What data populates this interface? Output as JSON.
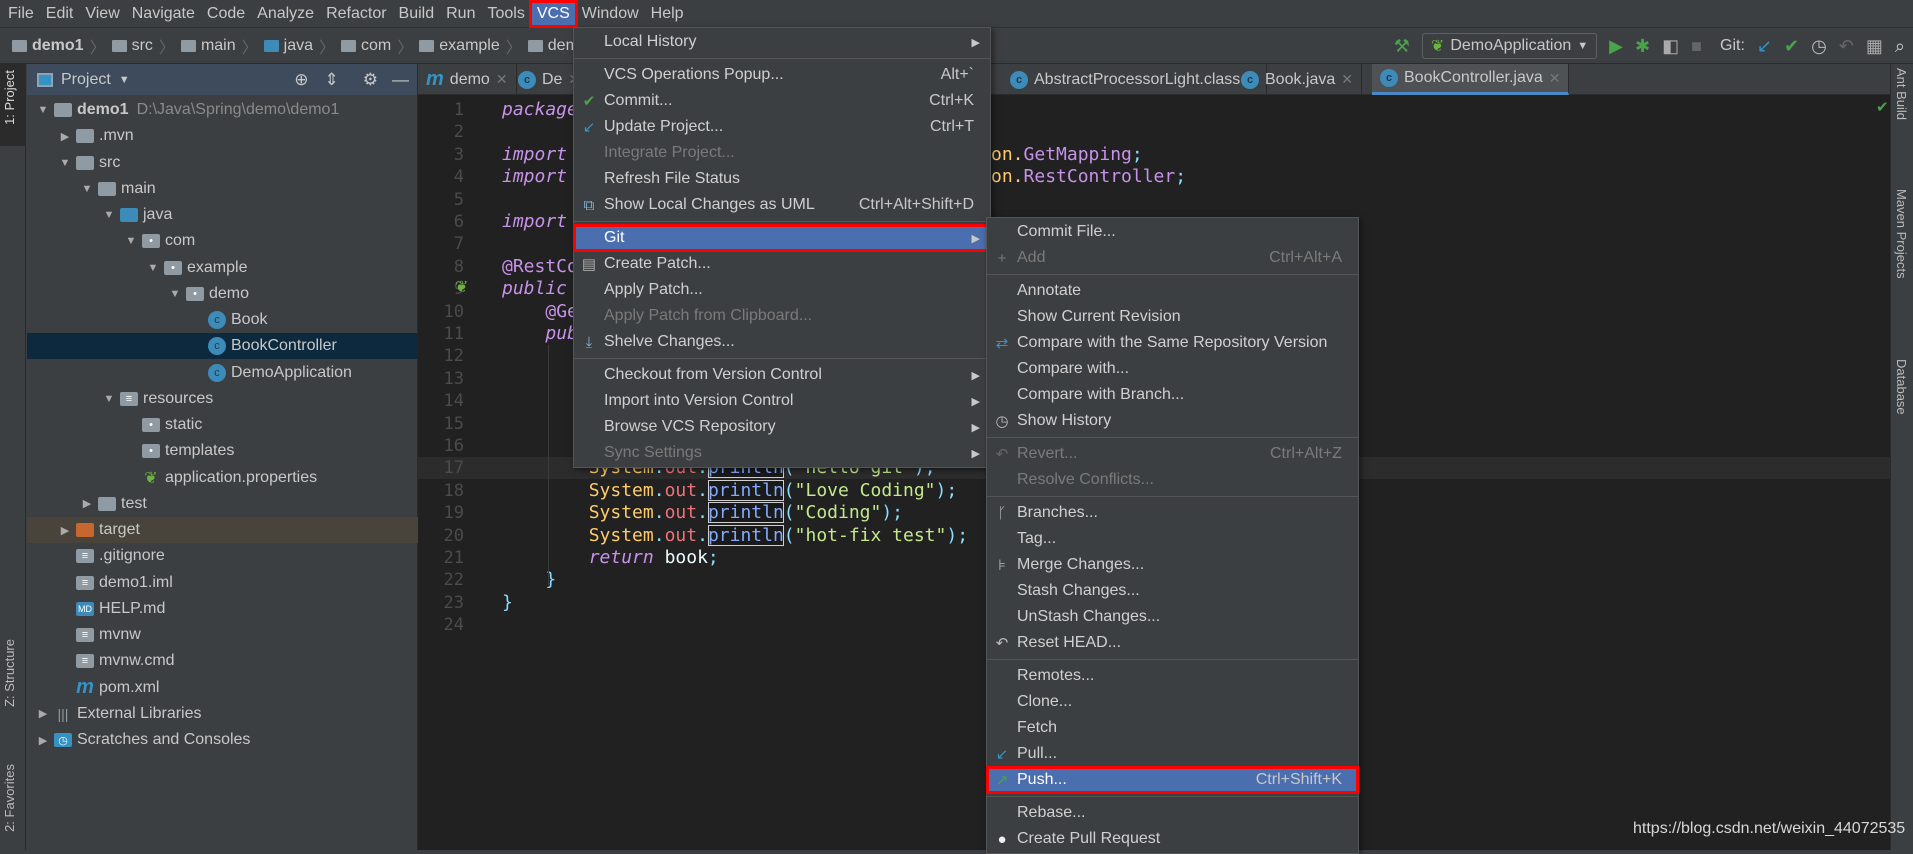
{
  "menubar": [
    "File",
    "Edit",
    "View",
    "Navigate",
    "Code",
    "Analyze",
    "Refactor",
    "Build",
    "Run",
    "Tools",
    "VCS",
    "Window",
    "Help"
  ],
  "menubar_active": "VCS",
  "breadcrumb": [
    "demo1",
    "src",
    "main",
    "java",
    "com",
    "example",
    "demo"
  ],
  "toolbar": {
    "run_config": "DemoApplication",
    "git_label": "Git:"
  },
  "left_stripe": {
    "project": "1: Project",
    "structure": "Z: Structure",
    "favorites": "2: Favorites"
  },
  "right_stripe": {
    "ant": "Ant Build",
    "maven": "Maven Projects",
    "database": "Database"
  },
  "project_panel": {
    "title": "Project",
    "tree": [
      {
        "label": "demo1",
        "hint": "D:\\Java\\Spring\\demo\\demo1",
        "depth": 0,
        "expand": "open",
        "icon": "module-folder",
        "bold": true
      },
      {
        "label": ".mvn",
        "depth": 1,
        "expand": "closed",
        "icon": "folder"
      },
      {
        "label": "src",
        "depth": 1,
        "expand": "open",
        "icon": "folder"
      },
      {
        "label": "main",
        "depth": 2,
        "expand": "open",
        "icon": "folder"
      },
      {
        "label": "java",
        "depth": 3,
        "expand": "open",
        "icon": "source-folder"
      },
      {
        "label": "com",
        "depth": 4,
        "expand": "open",
        "icon": "package"
      },
      {
        "label": "example",
        "depth": 5,
        "expand": "open",
        "icon": "package"
      },
      {
        "label": "demo",
        "depth": 6,
        "expand": "open",
        "icon": "package"
      },
      {
        "label": "Book",
        "depth": 7,
        "icon": "class"
      },
      {
        "label": "BookController",
        "depth": 7,
        "icon": "class",
        "selected": true
      },
      {
        "label": "DemoApplication",
        "depth": 7,
        "icon": "spring-class"
      },
      {
        "label": "resources",
        "depth": 3,
        "expand": "open",
        "icon": "resources-folder"
      },
      {
        "label": "static",
        "depth": 4,
        "icon": "package"
      },
      {
        "label": "templates",
        "depth": 4,
        "icon": "package"
      },
      {
        "label": "application.properties",
        "depth": 4,
        "icon": "spring-leaf"
      },
      {
        "label": "test",
        "depth": 2,
        "expand": "closed",
        "icon": "folder"
      },
      {
        "label": "target",
        "depth": 1,
        "expand": "closed",
        "icon": "excluded-folder",
        "highlight": true
      },
      {
        "label": ".gitignore",
        "depth": 1,
        "icon": "file"
      },
      {
        "label": "demo1.iml",
        "depth": 1,
        "icon": "file"
      },
      {
        "label": "HELP.md",
        "depth": 1,
        "icon": "markdown"
      },
      {
        "label": "mvnw",
        "depth": 1,
        "icon": "file"
      },
      {
        "label": "mvnw.cmd",
        "depth": 1,
        "icon": "file"
      },
      {
        "label": "pom.xml",
        "depth": 1,
        "icon": "maven"
      },
      {
        "label": "External Libraries",
        "depth": 0,
        "expand": "closed",
        "icon": "libraries"
      },
      {
        "label": "Scratches and Consoles",
        "depth": 0,
        "expand": "closed",
        "icon": "scratches"
      }
    ]
  },
  "tabs": [
    {
      "label": "demo",
      "icon": "maven"
    },
    {
      "label": "De",
      "icon": "spring-class"
    },
    {
      "label": "AbstractProcessorLight.class",
      "icon": "lock-class"
    },
    {
      "label": "Book.java",
      "icon": "class"
    },
    {
      "label": "BookController.java",
      "icon": "class",
      "active": true
    }
  ],
  "code": {
    "current_line": 17,
    "lines": [
      [
        [
          "kw",
          "package"
        ]
      ],
      [],
      [
        [
          "kw",
          "import"
        ],
        [
          "cut",
          ""
        ],
        [
          "pk",
          "on."
        ],
        [
          "cls",
          "GetMapping"
        ],
        [
          "pun",
          ";"
        ]
      ],
      [
        [
          "kw",
          "import"
        ],
        [
          "cut",
          ""
        ],
        [
          "pk",
          "on."
        ],
        [
          "cls",
          "RestController"
        ],
        [
          "pun",
          ";"
        ]
      ],
      [],
      [
        [
          "kw",
          "import"
        ]
      ],
      [],
      [
        [
          "ann",
          "@RestCo"
        ]
      ],
      [
        [
          "kw",
          "public"
        ]
      ],
      [
        [
          "var",
          "    "
        ],
        [
          "ann",
          "@Ge"
        ]
      ],
      [
        [
          "var",
          "    "
        ],
        [
          "kw",
          "pub"
        ]
      ],
      [],
      [],
      [],
      [],
      [],
      [
        [
          "var",
          "        "
        ],
        [
          "sys",
          "System"
        ],
        [
          "pun",
          "."
        ],
        [
          "fld",
          "out"
        ],
        [
          "pun",
          "."
        ],
        [
          "mth",
          "println"
        ],
        [
          "pun",
          "("
        ],
        [
          "str",
          "\"hello git\""
        ],
        [
          "pun",
          ");"
        ]
      ],
      [
        [
          "var",
          "        "
        ],
        [
          "sys",
          "System"
        ],
        [
          "pun",
          "."
        ],
        [
          "fld",
          "out"
        ],
        [
          "pun",
          "."
        ],
        [
          "mth",
          "println"
        ],
        [
          "pun",
          "("
        ],
        [
          "str",
          "\"Love Coding\""
        ],
        [
          "pun",
          ");"
        ]
      ],
      [
        [
          "var",
          "        "
        ],
        [
          "sys",
          "System"
        ],
        [
          "pun",
          "."
        ],
        [
          "fld",
          "out"
        ],
        [
          "pun",
          "."
        ],
        [
          "mth",
          "println"
        ],
        [
          "pun",
          "("
        ],
        [
          "str",
          "\"Coding\""
        ],
        [
          "pun",
          ");"
        ]
      ],
      [
        [
          "var",
          "        "
        ],
        [
          "sys",
          "System"
        ],
        [
          "pun",
          "."
        ],
        [
          "fld",
          "out"
        ],
        [
          "pun",
          "."
        ],
        [
          "mth",
          "println"
        ],
        [
          "pun",
          "("
        ],
        [
          "str",
          "\"hot-fix test\""
        ],
        [
          "pun",
          ");"
        ]
      ],
      [
        [
          "var",
          "        "
        ],
        [
          "kw",
          "return"
        ],
        [
          "var",
          " book"
        ],
        [
          "pun",
          ";"
        ]
      ],
      [
        [
          "var",
          "    "
        ],
        [
          "pun",
          "}"
        ]
      ],
      [
        [
          "pun",
          "}"
        ]
      ],
      []
    ]
  },
  "vcs_menu": [
    {
      "label": "Local History",
      "submenu": true
    },
    {
      "sep": true
    },
    {
      "label": "VCS Operations Popup...",
      "shortcut": "Alt+`"
    },
    {
      "label": "Commit...",
      "shortcut": "Ctrl+K",
      "icon": "check-icon"
    },
    {
      "label": "Update Project...",
      "shortcut": "Ctrl+T",
      "icon": "update-icon"
    },
    {
      "label": "Integrate Project...",
      "disabled": true
    },
    {
      "label": "Refresh File Status"
    },
    {
      "label": "Show Local Changes as UML",
      "shortcut": "Ctrl+Alt+Shift+D",
      "icon": "uml-icon"
    },
    {
      "sep": true
    },
    {
      "label": "Git",
      "submenu": true,
      "selected": true,
      "boxed": true
    },
    {
      "label": "Create Patch...",
      "icon": "patch-icon"
    },
    {
      "label": "Apply Patch..."
    },
    {
      "label": "Apply Patch from Clipboard...",
      "disabled": true
    },
    {
      "label": "Shelve Changes...",
      "icon": "shelve-icon"
    },
    {
      "sep": true
    },
    {
      "label": "Checkout from Version Control",
      "submenu": true
    },
    {
      "label": "Import into Version Control",
      "submenu": true
    },
    {
      "label": "Browse VCS Repository",
      "submenu": true
    },
    {
      "label": "Sync Settings",
      "submenu": true,
      "disabled": true
    }
  ],
  "git_menu": [
    {
      "label": "Commit File..."
    },
    {
      "label": "Add",
      "shortcut": "Ctrl+Alt+A",
      "disabled": true,
      "icon": "plus-icon"
    },
    {
      "sep": true
    },
    {
      "label": "Annotate"
    },
    {
      "label": "Show Current Revision"
    },
    {
      "label": "Compare with the Same Repository Version",
      "icon": "compare-icon"
    },
    {
      "label": "Compare with..."
    },
    {
      "label": "Compare with Branch..."
    },
    {
      "label": "Show History",
      "icon": "history-icon"
    },
    {
      "sep": true
    },
    {
      "label": "Revert...",
      "shortcut": "Ctrl+Alt+Z",
      "disabled": true,
      "icon": "revert-icon"
    },
    {
      "label": "Resolve Conflicts...",
      "disabled": true
    },
    {
      "sep": true
    },
    {
      "label": "Branches...",
      "icon": "branch-icon"
    },
    {
      "label": "Tag..."
    },
    {
      "label": "Merge Changes...",
      "icon": "merge-icon"
    },
    {
      "label": "Stash Changes..."
    },
    {
      "label": "UnStash Changes..."
    },
    {
      "label": "Reset HEAD...",
      "icon": "reset-icon"
    },
    {
      "sep": true
    },
    {
      "label": "Remotes..."
    },
    {
      "label": "Clone..."
    },
    {
      "label": "Fetch"
    },
    {
      "label": "Pull...",
      "icon": "pull-icon"
    },
    {
      "label": "Push...",
      "shortcut": "Ctrl+Shift+K",
      "icon": "push-icon",
      "selected": true,
      "boxed": true
    },
    {
      "sep": true
    },
    {
      "label": "Rebase..."
    },
    {
      "label": "Create Pull Request",
      "icon": "github-icon"
    }
  ],
  "watermark": "https://blog.csdn.net/weixin_44072535",
  "colors": {
    "selection": "#4b6eaf",
    "highlight_box": "#ff0000",
    "editor_bg": "#212121",
    "panel_bg": "#3c3f41"
  }
}
